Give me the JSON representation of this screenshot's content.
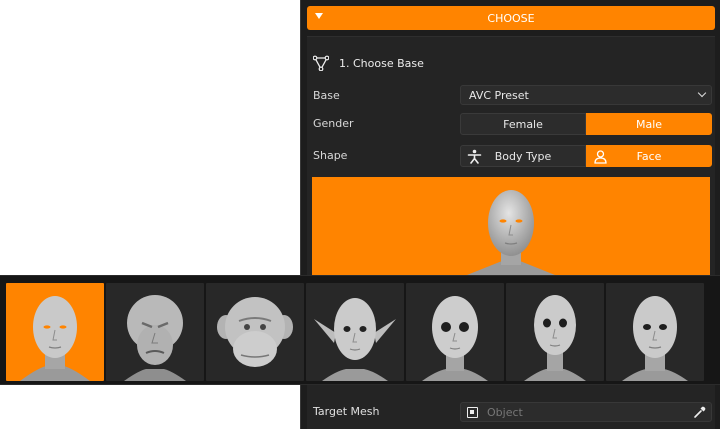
{
  "header": {
    "choose_label": "CHOOSE"
  },
  "section": {
    "title": "1. Choose Base",
    "base_label": "Base",
    "base_value": "AVC Preset",
    "gender_label": "Gender",
    "gender_options": [
      "Female",
      "Male"
    ],
    "gender_selected": "Male",
    "shape_label": "Shape",
    "shape_options": [
      "Body Type",
      "Face"
    ],
    "shape_selected": "Face",
    "target_label": "Target Mesh",
    "target_placeholder": "Object"
  },
  "gallery": {
    "selected_index": 0,
    "items": [
      {
        "icon": "human-head-icon"
      },
      {
        "icon": "alien-head-icon"
      },
      {
        "icon": "monkey-head-icon"
      },
      {
        "icon": "elf-head-icon"
      },
      {
        "icon": "doll-head-icon"
      },
      {
        "icon": "female-head-icon"
      },
      {
        "icon": "asian-head-icon"
      }
    ]
  },
  "colors": {
    "accent": "#ff8400",
    "panel": "#1d1d1d",
    "field": "#2c2c2c"
  }
}
